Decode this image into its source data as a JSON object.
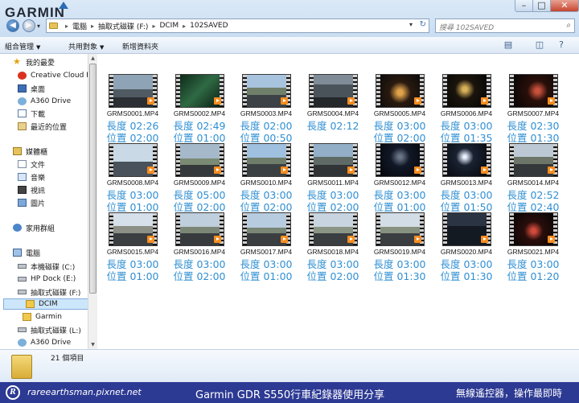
{
  "brand": "GARMIN",
  "window_controls": {
    "minimize": "–",
    "maximize": "□",
    "close": "✕"
  },
  "nav": {
    "back_icon": "◀",
    "forward_icon": "▶",
    "dropdown_icon": "▾"
  },
  "address": {
    "crumbs": [
      "電腦",
      "抽取式磁碟 (F:)",
      "DCIM",
      "102SAVED"
    ],
    "separator": "▸",
    "dropdown_icon": "▾",
    "refresh_icon": "↻"
  },
  "search": {
    "placeholder": "搜尋 102SAVED",
    "icon": "⌕"
  },
  "toolbar": {
    "organize": "組合管理",
    "share": "共用對象",
    "new_folder": "新增資料夾",
    "arrow": "▼",
    "view_icon": "▤",
    "preview_icon": "◫",
    "help_icon": "?"
  },
  "sidebar": {
    "items": [
      {
        "label": "我的最愛",
        "icon": "star"
      },
      {
        "label": "Creative Cloud F",
        "icon": "cc"
      },
      {
        "label": "桌面",
        "icon": "desk"
      },
      {
        "label": "A360 Drive",
        "icon": "cloud"
      },
      {
        "label": "下載",
        "icon": "dl"
      },
      {
        "label": "最近的位置",
        "icon": "recent"
      },
      {
        "label": "媒體櫃",
        "icon": "lib"
      },
      {
        "label": "文件",
        "icon": "doc"
      },
      {
        "label": "音樂",
        "icon": "music"
      },
      {
        "label": "視訊",
        "icon": "video"
      },
      {
        "label": "圖片",
        "icon": "pic"
      },
      {
        "label": "家用群組",
        "icon": "net"
      },
      {
        "label": "電腦",
        "icon": "pc"
      },
      {
        "label": "本機磁碟 (C:)",
        "icon": "hdd"
      },
      {
        "label": "HP Dock (E:)",
        "icon": "hdd"
      },
      {
        "label": "抽取式磁碟 (F:)",
        "icon": "hdd"
      },
      {
        "label": "DCIM",
        "icon": "folder"
      },
      {
        "label": "Garmin",
        "icon": "folder"
      },
      {
        "label": "抽取式磁碟 (L:)",
        "icon": "hdd"
      },
      {
        "label": "A360 Drive",
        "icon": "cloud"
      }
    ],
    "scroll_up": "▲",
    "scroll_down": "▼"
  },
  "files": [
    {
      "name": "GRMS0001.MP4",
      "length": "長度 02:26",
      "position": "位置 02:00"
    },
    {
      "name": "GRMS0002.MP4",
      "length": "長度 02:49",
      "position": "位置 01:00"
    },
    {
      "name": "GRMS0003.MP4",
      "length": "長度 02:00",
      "position": "位置 00:50"
    },
    {
      "name": "GRMS0004.MP4",
      "length": "長度 02:12",
      "position": ""
    },
    {
      "name": "GRMS0005.MP4",
      "length": "長度 03:00",
      "position": "位置 02:00"
    },
    {
      "name": "GRMS0006.MP4",
      "length": "長度 03:00",
      "position": "位置 01:35"
    },
    {
      "name": "GRMS0007.MP4",
      "length": "長度 02:30",
      "position": "位置 01:30"
    },
    {
      "name": "GRMS0008.MP4",
      "length": "長度 03:00",
      "position": "位置 01:00"
    },
    {
      "name": "GRMS0009.MP4",
      "length": "長度 05:00",
      "position": "位置 02:00"
    },
    {
      "name": "GRMS0010.MP4",
      "length": "長度 03:00",
      "position": "位置 02:00"
    },
    {
      "name": "GRMS0011.MP4",
      "length": "長度 03:00",
      "position": "位置 02:00"
    },
    {
      "name": "GRMS0012.MP4",
      "length": "長度 03:00",
      "position": "位置 01:00"
    },
    {
      "name": "GRMS0013.MP4",
      "length": "長度 03:00",
      "position": "位置 01:50"
    },
    {
      "name": "GRMS0014.MP4",
      "length": "長度 02:52",
      "position": "位置 02:40"
    },
    {
      "name": "GRMS0015.MP4",
      "length": "長度 03:00",
      "position": "位置 01:00"
    },
    {
      "name": "GRMS0016.MP4",
      "length": "長度 03:00",
      "position": "位置 02:00"
    },
    {
      "name": "GRMS0017.MP4",
      "length": "長度 03:00",
      "position": "位置 01:00"
    },
    {
      "name": "GRMS0018.MP4",
      "length": "長度 03:00",
      "position": "位置 02:00"
    },
    {
      "name": "GRMS0019.MP4",
      "length": "長度 03:00",
      "position": "位置 01:30"
    },
    {
      "name": "GRMS0020.MP4",
      "length": "長度 03:00",
      "position": "位置 01:30"
    },
    {
      "name": "GRMS0021.MP4",
      "length": "長度 03:00",
      "position": "位置 01:20"
    }
  ],
  "details": {
    "count": "21 個項目"
  },
  "banner": {
    "logo": "R",
    "site": "rareearthsman.pixnet.net",
    "title": "Garmin GDR S550行車紀錄器使用分享",
    "right": "無線遙控器，操作最即時"
  }
}
